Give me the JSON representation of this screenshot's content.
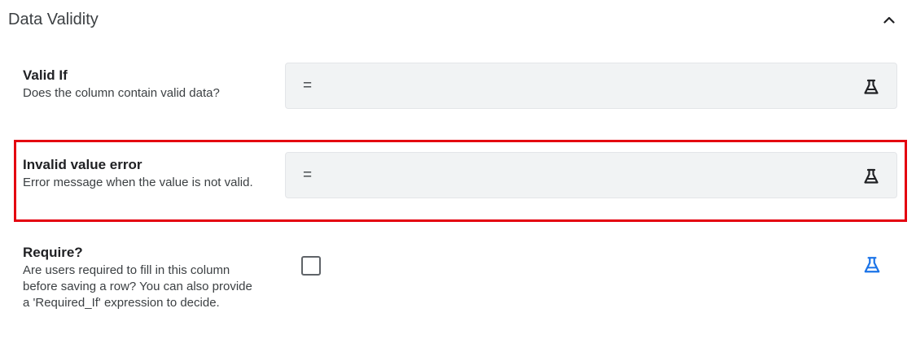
{
  "section": {
    "title": "Data Validity",
    "collapse_icon": "chevron-up-icon"
  },
  "valid_if": {
    "title": "Valid If",
    "description": "Does the column contain valid data?",
    "expression": "=",
    "test_icon": "flask-icon"
  },
  "invalid_value_error": {
    "title": "Invalid value error",
    "description": "Error message when the value is not valid.",
    "expression": "=",
    "test_icon": "flask-icon",
    "highlight_color": "#e4000f"
  },
  "require": {
    "title": "Require?",
    "description": "Are users required to fill in this column before saving a row? You can also provide a 'Required_If' expression to decide.",
    "checked": false,
    "test_icon": "flask-icon",
    "test_icon_color": "#1a73e8"
  }
}
